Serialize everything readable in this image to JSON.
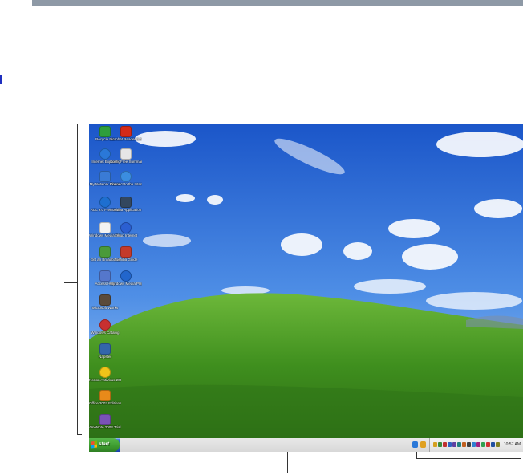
{
  "desktop": {
    "icons": [
      {
        "label": "Recycle Bin",
        "icon": "recycle-bin-icon",
        "color": "#2e9e3b"
      },
      {
        "label": "Acrobat Reader 6.0",
        "icon": "acrobat-icon",
        "color": "#d42a1a"
      },
      {
        "label": "Internet Explorer",
        "icon": "internet-explorer-icon",
        "color": "#2a78d8"
      },
      {
        "label": "ConfigFree Summary",
        "icon": "configfree-icon",
        "color": "#e6e6e6"
      },
      {
        "label": "My Network Places",
        "icon": "network-places-icon",
        "color": "#3a7bd5"
      },
      {
        "label": "Connect to the Internet",
        "icon": "connect-internet-icon",
        "color": "#3b8de0"
      },
      {
        "label": "AOL 9.0 Free Trial",
        "icon": "aol-icon",
        "color": "#1e6fd0"
      },
      {
        "label": "Toshiba Application",
        "icon": "toshiba-app-icon",
        "color": "#33475f"
      },
      {
        "label": "Windows Media Player",
        "icon": "document-icon",
        "color": "#f2f2f2"
      },
      {
        "label": "Setup Internet",
        "icon": "setup-internet-icon",
        "color": "#2b5fd1"
      },
      {
        "label": "Get an Broadband",
        "icon": "broadband-icon",
        "color": "#4a9a3a"
      },
      {
        "label": "Toshiba Guide",
        "icon": "toshiba-guide-icon",
        "color": "#c43a2a"
      },
      {
        "label": "Access Help",
        "icon": "access-help-icon",
        "color": "#5577cc"
      },
      {
        "label": "Windows Media Player",
        "icon": "media-player-icon",
        "color": "#2266cc"
      },
      {
        "label": "Microsoft Works",
        "icon": "works-icon",
        "color": "#5a4a3a"
      },
      {
        "label": "Windows Catalog",
        "icon": "catalog-icon",
        "color": "#c83030"
      },
      {
        "label": "Napster",
        "icon": "napster-icon",
        "color": "#3366aa"
      },
      {
        "label": "Norton AntiVirus 2003",
        "icon": "norton-icon",
        "color": "#f0c419"
      },
      {
        "label": "Office 2003 Editions",
        "icon": "office-icon",
        "color": "#e88a1a"
      },
      {
        "label": "OneNote 2003 Trial",
        "icon": "onenote-icon",
        "color": "#7a52b8"
      }
    ]
  },
  "taskbar": {
    "start_label": "start",
    "quick_launch_colors": [
      "#2a78d8",
      "#e0a020"
    ],
    "tray_icon_colors": [
      "#d4a020",
      "#3a8a3a",
      "#c03030",
      "#3060c0",
      "#6040a0",
      "#208080",
      "#c06020",
      "#404040",
      "#3080d0",
      "#a02080",
      "#30a050",
      "#d03030",
      "#2050a0",
      "#808020"
    ],
    "clock": "10:57 AM"
  }
}
